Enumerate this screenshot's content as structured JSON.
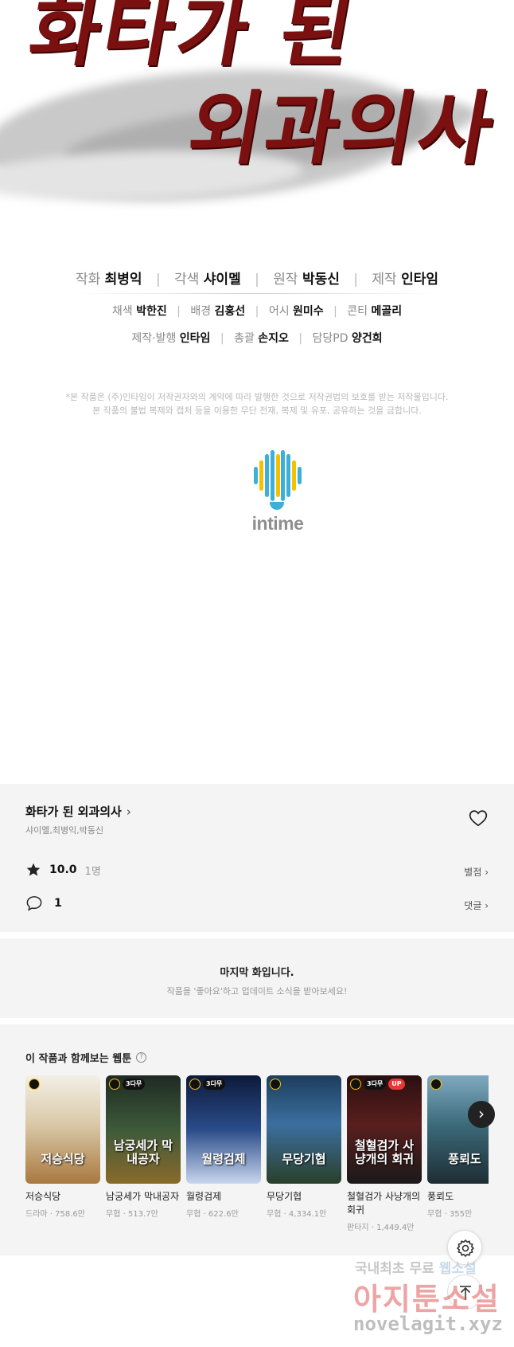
{
  "cover": {
    "title_line1": "화타가 된",
    "title_line2": "외과의사"
  },
  "credits": {
    "line1": [
      {
        "role": "작화",
        "name": "최병익"
      },
      {
        "role": "각색",
        "name": "샤이멜"
      },
      {
        "role": "원작",
        "name": "박동신"
      },
      {
        "role": "제작",
        "name": "인타임"
      }
    ],
    "line2": [
      {
        "role": "채색",
        "name": "박한진"
      },
      {
        "role": "배경",
        "name": "김홍선"
      },
      {
        "role": "어시",
        "name": "원미수"
      },
      {
        "role": "콘티",
        "name": "메골리"
      }
    ],
    "line3": [
      {
        "role": "제작·발행",
        "name": "인타임"
      },
      {
        "role": "총괄",
        "name": "손지오"
      },
      {
        "role": "담당PD",
        "name": "양건희"
      }
    ],
    "separator": "|"
  },
  "notice": {
    "line1": "*본 작품은 (주)인타임이 저작권자와의 계약에 따라 발행한 것으로 저작권법의 보호를 받는 저작물입니다.",
    "line2": "본 작품의 불법 복제와 캡처 등을 이용한 무단 전재, 복제 및 유포, 공유하는 것을 금합니다."
  },
  "publisher_logo": {
    "text": "intime",
    "bar_colors": [
      "#3cb0d8",
      "#f2c200",
      "#3cb0d8",
      "#3cb0d8",
      "#f2c200",
      "#3cb0d8",
      "#3cb0d8",
      "#f2c200",
      "#3cb0d8"
    ]
  },
  "info": {
    "title": "화타가 된 외과의사",
    "title_chevron": "›",
    "authors": "샤이멜,최병익,박동신",
    "rating": "10.0",
    "rating_count": "1명",
    "rate_link": "별점 ›",
    "comment_count": "1",
    "comment_link": "댓글 ›"
  },
  "last_episode": {
    "heading": "마지막 화입니다.",
    "sub": "작품을 '좋아요'하고 업데이트 소식을 받아보세요!"
  },
  "recommendations": {
    "heading": "이 작품과 함께보는 웹툰",
    "help": "?",
    "items": [
      {
        "title": "저승식당",
        "meta": "드라마 · 758.6만",
        "art": "저승식당",
        "tag": "",
        "up": "",
        "bg": "linear-gradient(180deg,#f3efe6 0%,#d9c9a8 45%,#a9783e 100%)"
      },
      {
        "title": "남궁세가 막내공자",
        "meta": "무협 · 513.7만",
        "art": "남궁세가 막내공자",
        "tag": "3다무",
        "up": "",
        "bg": "linear-gradient(180deg,#1e2a22 0%,#3d5a3a 50%,#8a6a2a 100%)"
      },
      {
        "title": "월령검제",
        "meta": "무협 · 622.6만",
        "art": "월령검제",
        "tag": "3다무",
        "up": "",
        "bg": "linear-gradient(180deg,#0c1a3a 0%,#2a4c8a 50%,#c9d6ee 100%)"
      },
      {
        "title": "무당기협",
        "meta": "무협 · 4,334.1만",
        "art": "무당기협",
        "tag": "",
        "up": "",
        "bg": "linear-gradient(180deg,#1d3d5c 0%,#3b6fa0 45%,#2a3f2a 100%)"
      },
      {
        "title": "철혈검가 사냥개의 회귀",
        "meta": "판타지 · 1,449.4만",
        "art": "철혈검가 사냥개의 회귀",
        "tag": "3다무",
        "up": "UP",
        "bg": "linear-gradient(180deg,#2a0f10 0%,#5a1e1e 45%,#1a1a1a 100%)"
      },
      {
        "title": "풍뢰도",
        "meta": "무협 · 355만",
        "art": "풍뢰도",
        "tag": "",
        "up": "",
        "bg": "linear-gradient(180deg,#7fa9c0 0%,#3c6b7a 45%,#1d2c33 100%)"
      }
    ],
    "next": "›"
  },
  "watermark": {
    "line1_a": "국내최초 무료",
    "line1_b": "웹소설",
    "line2": "아지툰소설",
    "line3": "novelagit.xyz"
  }
}
